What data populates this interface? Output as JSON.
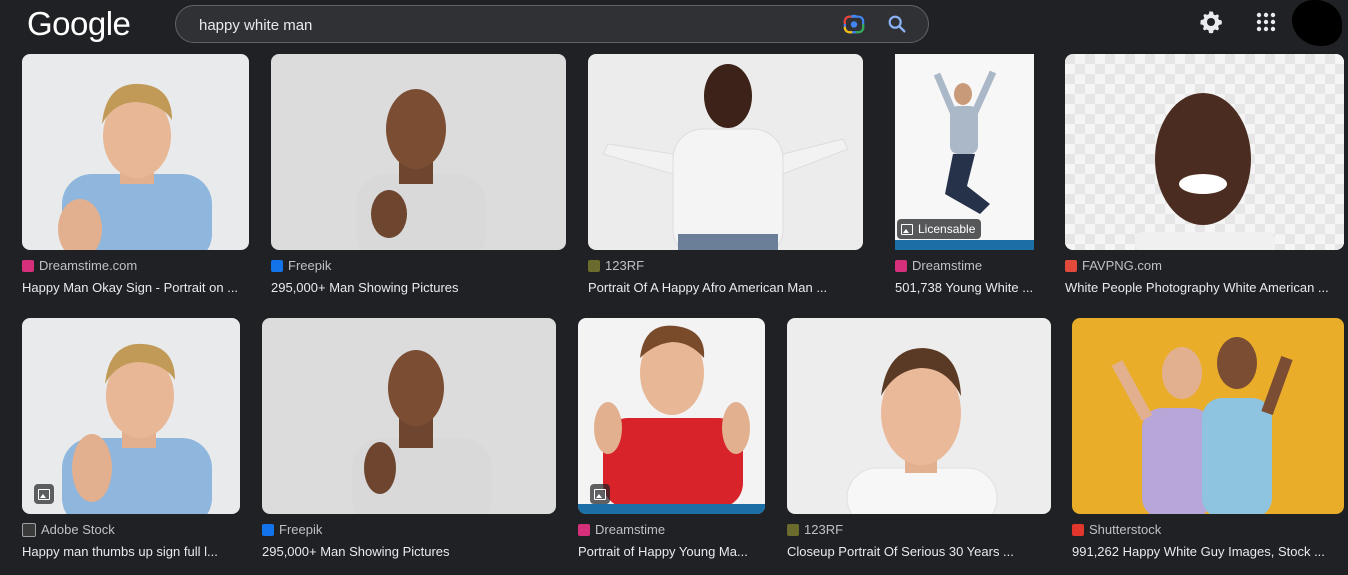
{
  "header": {
    "logo_text": "Google",
    "query": "happy white man",
    "icons": [
      "camera-lens-icon",
      "search-icon",
      "gear-icon",
      "apps-grid-icon"
    ]
  },
  "results": [
    {
      "source": "Dreamstime.com",
      "title": "Happy Man Okay Sign - Portrait on ...",
      "favicon_color": "#d62f7b",
      "bg": "#e9eaec"
    },
    {
      "source": "Freepik",
      "title": "295,000+ Man Showing Pictures",
      "favicon_color": "#1273eb",
      "bg": "#dddddd"
    },
    {
      "source": "123RF",
      "title": "Portrait Of A Happy Afro American Man ...",
      "favicon_color": "#6b6b2e",
      "bg": "#ececec"
    },
    {
      "source": "Dreamstime",
      "title": "501,738 Young White ...",
      "favicon_color": "#d62f7b",
      "bg": "#f7f7f7",
      "badge": "Licensable"
    },
    {
      "source": "FAVPNG.com",
      "title": "White People Photography White American ...",
      "favicon_color": "#e24a3b",
      "bg": "#eeeeee"
    },
    {
      "source": "Adobe Stock",
      "title": "Happy man thumbs up sign full l...",
      "favicon_color": "#3a3a3a",
      "bg": "#e9eaec"
    },
    {
      "source": "Freepik",
      "title": "295,000+ Man Showing Pictures",
      "favicon_color": "#1273eb",
      "bg": "#dddddd"
    },
    {
      "source": "Dreamstime",
      "title": "Portrait of Happy Young Ma...",
      "favicon_color": "#d62f7b",
      "bg": "#f3f3f3"
    },
    {
      "source": "123RF",
      "title": "Closeup Portrait Of Serious 30 Years ...",
      "favicon_color": "#6b6b2e",
      "bg": "#ededed"
    },
    {
      "source": "Shutterstock",
      "title": "991,262 Happy White Guy Images, Stock ...",
      "favicon_color": "#e2352b",
      "bg": "#e9ad2a"
    }
  ]
}
